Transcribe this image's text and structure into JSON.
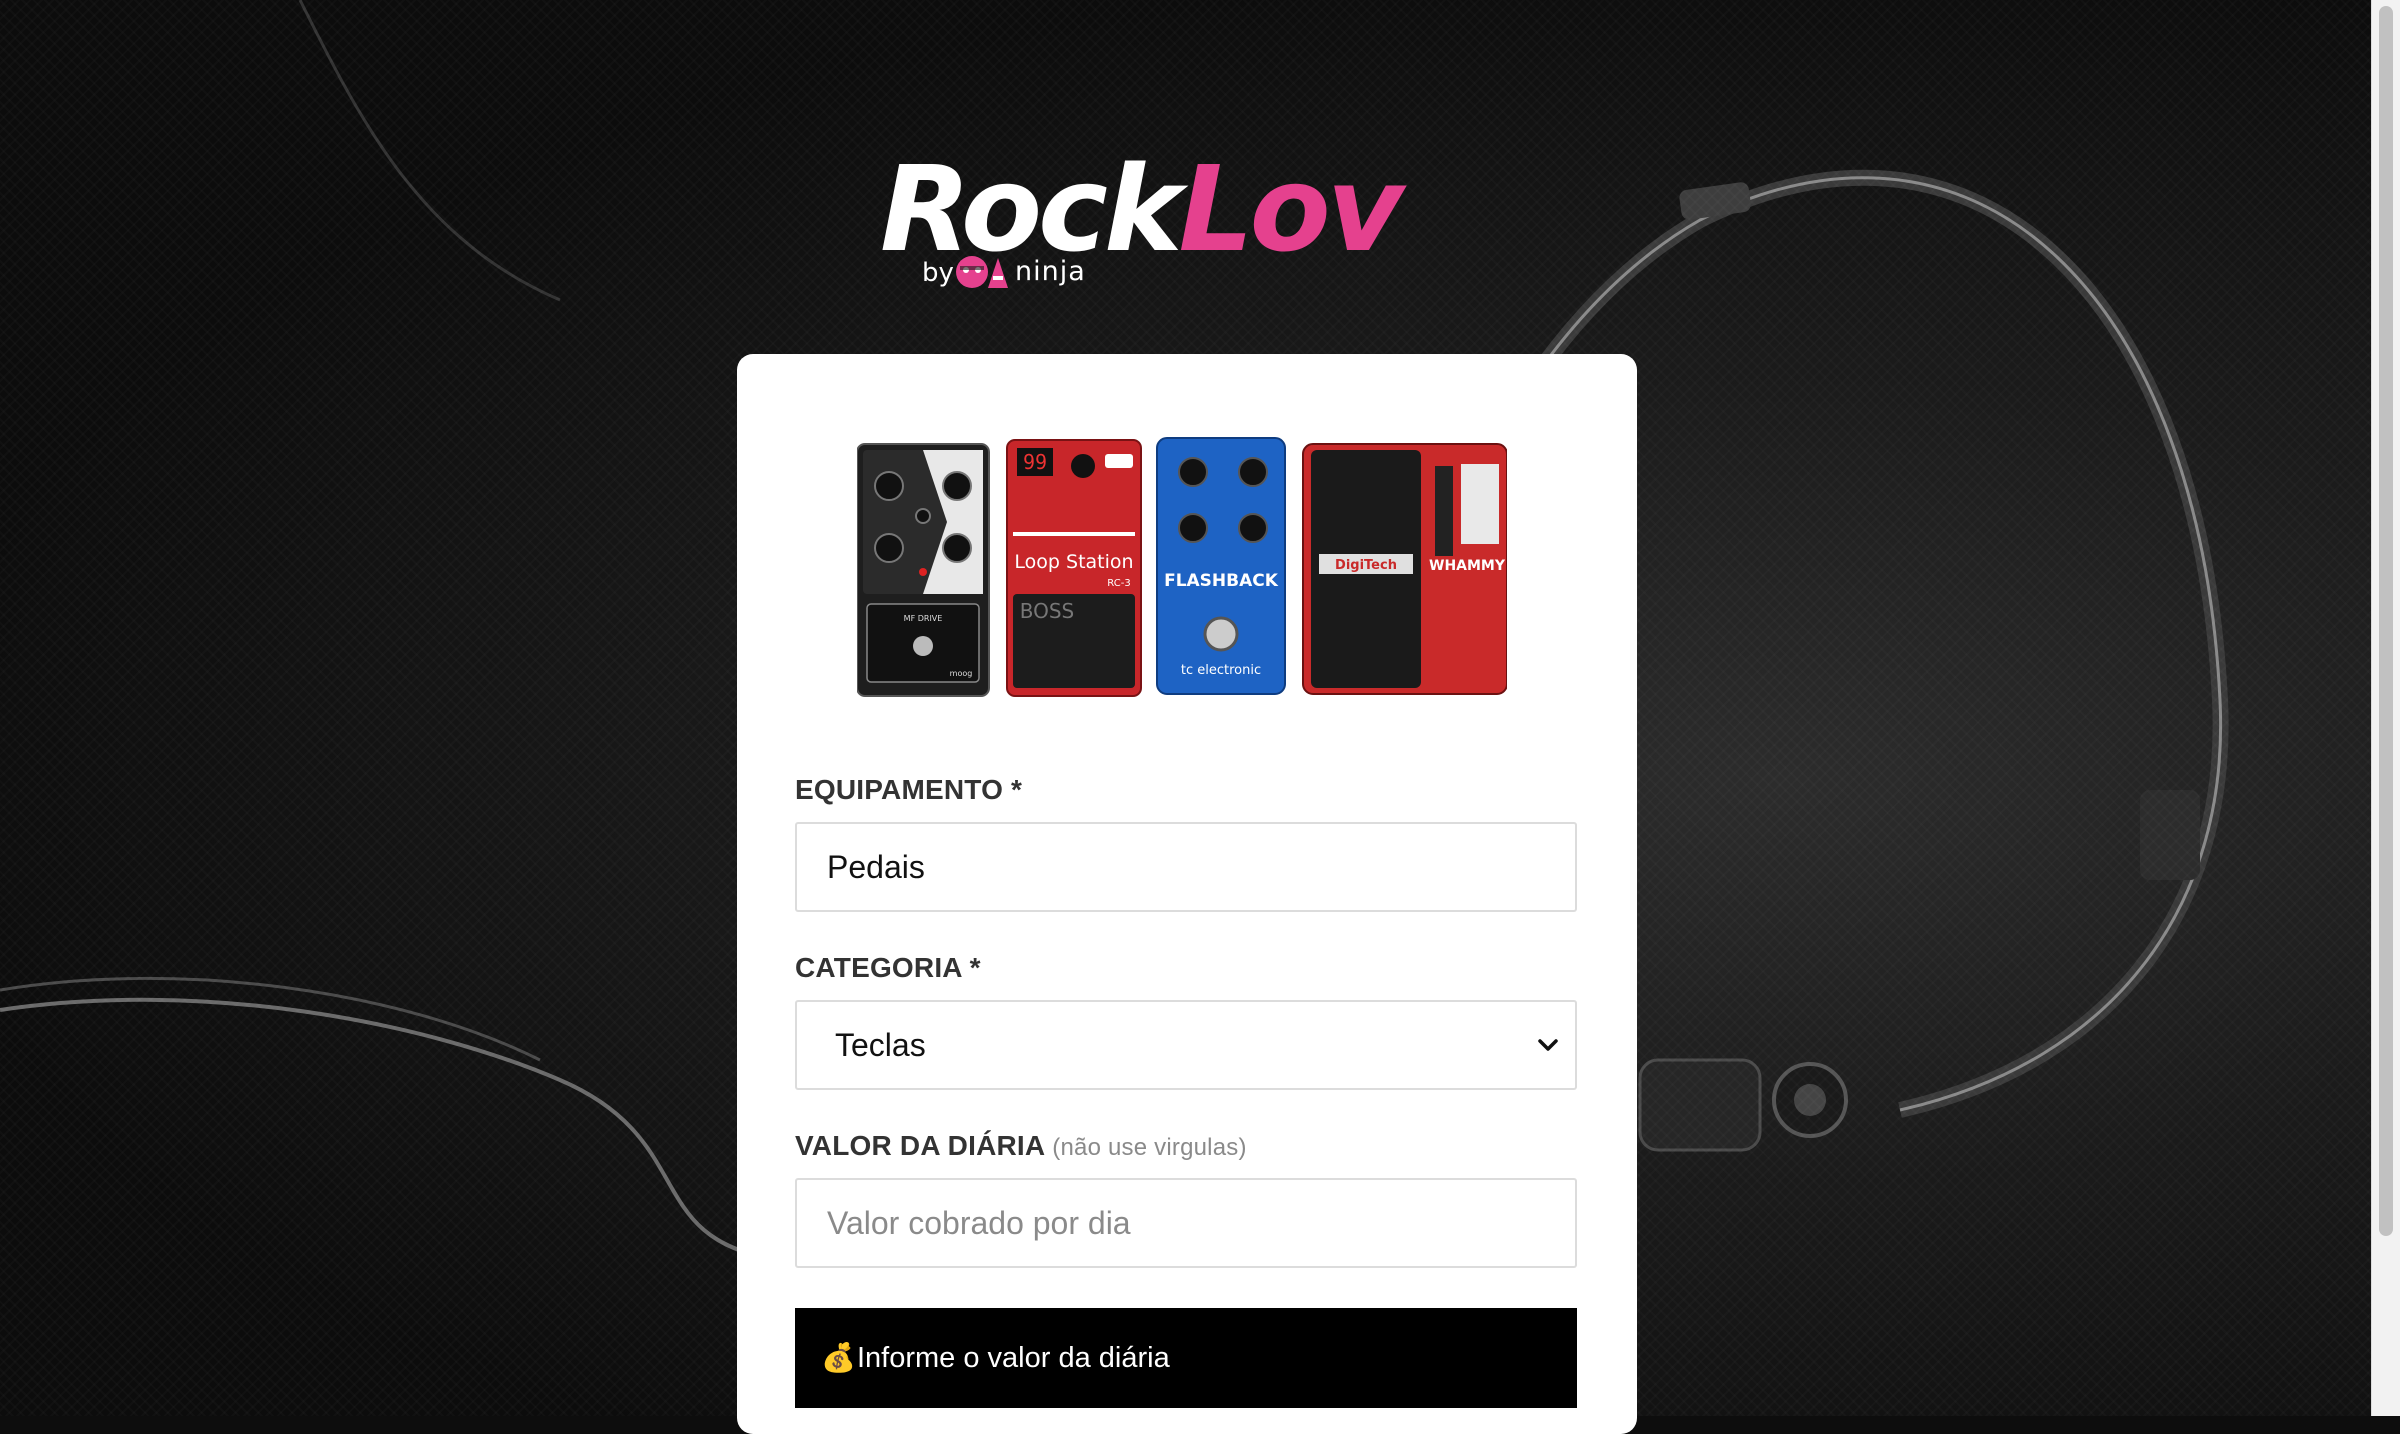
{
  "brand": {
    "name_part1": "Rock",
    "name_part2": "Lov",
    "by": "by",
    "qa_mark": "QA",
    "ninja": "ninja",
    "colors": {
      "white": "#ffffff",
      "pink": "#e5418e"
    }
  },
  "form": {
    "equipment": {
      "label": "EQUIPAMENTO *",
      "value": "Pedais"
    },
    "category": {
      "label": "CATEGORIA *",
      "selected": "Teclas"
    },
    "daily_rate": {
      "label": "VALOR DA DIÁRIA",
      "hint": "(não use virgulas)",
      "placeholder": "Valor cobrado por dia"
    }
  },
  "alert": {
    "icon": "money-bag-icon",
    "glyph": "💰",
    "text": "Informe o valor da diária"
  },
  "pedal_labels": {
    "loop_station": "Loop Station",
    "rc3": "RC-3",
    "boss": "BOSS",
    "counter": "99",
    "flashback": "FLASHBACK",
    "tc": "tc electronic",
    "digitech": "DigiTech",
    "whammy": "WHAMMY",
    "mf_drive": "MF DRIVE",
    "moog": "moog"
  }
}
